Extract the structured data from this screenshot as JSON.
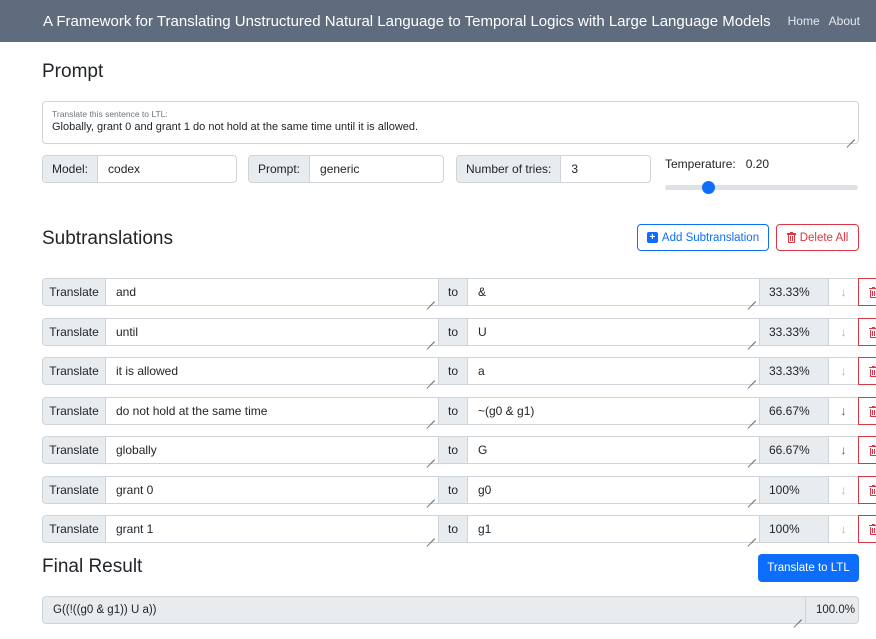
{
  "navbar": {
    "title": "A Framework for Translating Unstructured Natural Language to Temporal Logics with Large Language Models",
    "links": [
      "Home",
      "About"
    ]
  },
  "prompt": {
    "heading": "Prompt",
    "small_label": "Translate this sentence to LTL:",
    "text": "Globally, grant 0 and grant 1 do not hold at the same time until it is allowed."
  },
  "settings": {
    "model_label": "Model:",
    "model_value": "codex",
    "prompt_label": "Prompt:",
    "prompt_value": "generic",
    "tries_label": "Number of tries:",
    "tries_value": "3",
    "temperature_label": "Temperature:",
    "temperature_value": "0.20",
    "temperature_fraction": 0.2
  },
  "subtranslations": {
    "heading": "Subtranslations",
    "add_label": "Add Subtranslation",
    "delete_all_label": "Delete All",
    "translate_label": "Translate",
    "to_label": "to",
    "down_symbol": "↓",
    "rows": [
      {
        "source": "and",
        "target": "&",
        "confidence": "33.33%"
      },
      {
        "source": "until",
        "target": "U",
        "confidence": "33.33%"
      },
      {
        "source": "it is allowed",
        "target": "a",
        "confidence": "33.33%"
      },
      {
        "source": "do not hold at the same time",
        "target": "~(g0 & g1)",
        "confidence": "66.67%"
      },
      {
        "source": "globally",
        "target": "G",
        "confidence": "66.67%"
      },
      {
        "source": "grant 0",
        "target": "g0",
        "confidence": "100%"
      },
      {
        "source": "grant 1",
        "target": "g1",
        "confidence": "100%"
      }
    ]
  },
  "final_result": {
    "heading": "Final Result",
    "button_label": "Translate to LTL",
    "formula": "G((!((g0 & g1)) U a))",
    "confidence": "100.0%"
  },
  "colors": {
    "navbar_bg": "#5f6c7e",
    "primary": "#0d6efd",
    "danger": "#dc3545",
    "addon_bg": "#e9ecef"
  }
}
